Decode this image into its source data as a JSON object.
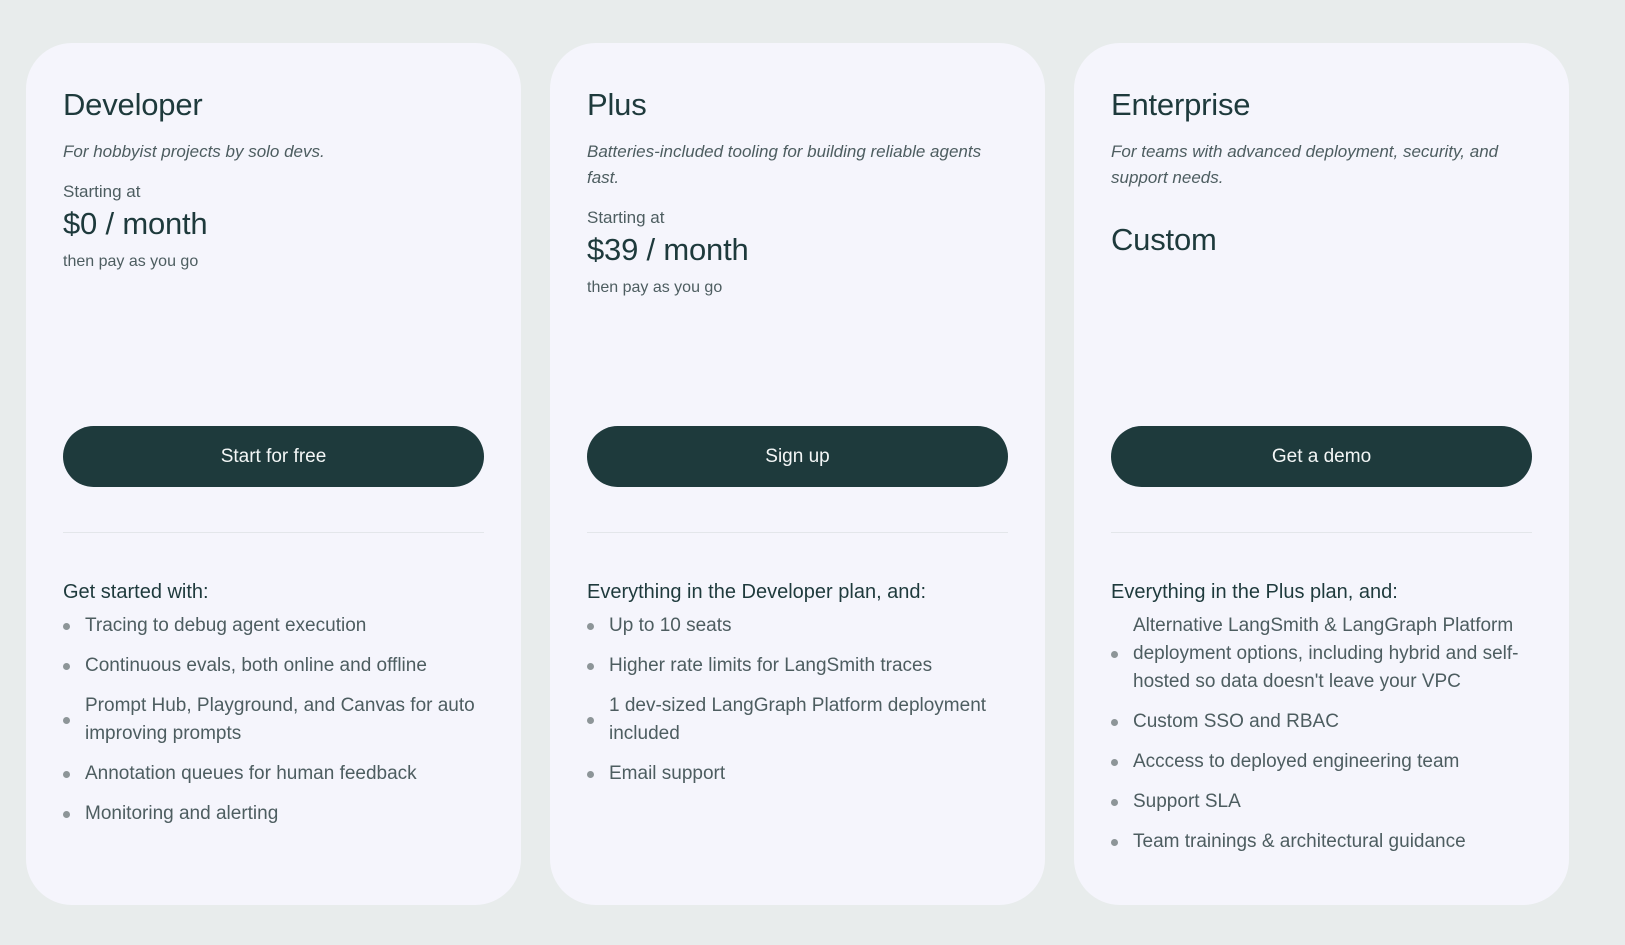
{
  "plans": [
    {
      "name": "Developer",
      "tagline": "For hobbyist projects by solo devs.",
      "starting_label": "Starting at",
      "price": "$0 / month",
      "after_price": "then pay as you go",
      "cta_label": "Start for free",
      "features_heading": "Get started with:",
      "features": [
        "Tracing to debug agent execution",
        "Continuous evals, both online and offline",
        "Prompt Hub, Playground, and Canvas for auto improving prompts",
        "Annotation queues for human feedback",
        "Monitoring and alerting"
      ]
    },
    {
      "name": "Plus",
      "tagline": "Batteries-included tooling for building reliable agents fast.",
      "starting_label": "Starting at",
      "price": "$39 / month",
      "after_price": "then pay as you go",
      "cta_label": "Sign up",
      "features_heading": "Everything in the Developer plan, and:",
      "features": [
        "Up to 10 seats",
        "Higher rate limits for LangSmith traces",
        "1 dev-sized LangGraph Platform deployment included",
        "Email support"
      ]
    },
    {
      "name": "Enterprise",
      "tagline": "For teams with advanced deployment, security, and support needs.",
      "price": "Custom",
      "cta_label": "Get a demo",
      "features_heading": "Everything in the Plus plan, and:",
      "features": [
        "Alternative LangSmith & LangGraph Platform deployment options, including hybrid and self-hosted so data doesn't leave your VPC",
        "Custom SSO and RBAC",
        "Acccess to deployed engineering team",
        "Support SLA",
        "Team trainings & architectural guidance"
      ]
    }
  ],
  "colors": {
    "page_background": "#e8ecec",
    "card_background": "#f5f5fc",
    "button_background": "#1e3a3c",
    "button_text": "#f3f6f6",
    "heading_text": "#1e3a3c",
    "body_text": "#4d5d60"
  }
}
